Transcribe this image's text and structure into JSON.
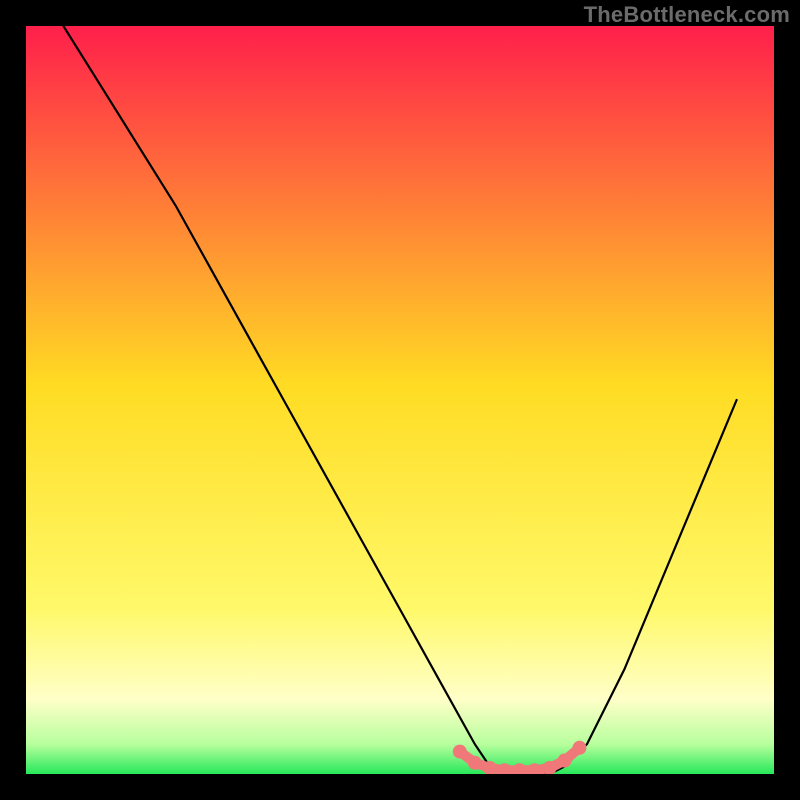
{
  "watermark": "TheBottleneck.com",
  "colors": {
    "bg": "#000000",
    "top": "#ff1f4b",
    "mid": "#ffdc23",
    "pale": "#ffffb0",
    "green": "#27e85a",
    "curve": "#000000",
    "marker": "#f07878"
  },
  "chart_data": {
    "type": "line",
    "title": "",
    "xlabel": "",
    "ylabel": "",
    "xlim": [
      0,
      100
    ],
    "ylim": [
      0,
      100
    ],
    "grid": false,
    "legend": false,
    "series": [
      {
        "name": "bottleneck-curve",
        "x": [
          5,
          10,
          15,
          20,
          25,
          30,
          35,
          40,
          45,
          50,
          55,
          60,
          62,
          65,
          68,
          70,
          72,
          75,
          80,
          85,
          90,
          95
        ],
        "values": [
          100,
          92,
          84,
          76,
          67,
          58,
          49,
          40,
          31,
          22,
          13,
          4,
          1,
          0,
          0,
          0,
          1,
          4,
          14,
          26,
          38,
          50
        ]
      }
    ],
    "markers": {
      "name": "highlighted-range",
      "style": "pink-dots",
      "x": [
        58,
        60,
        62,
        64,
        66,
        68,
        70,
        72,
        74
      ],
      "values": [
        3,
        1.5,
        0.8,
        0.5,
        0.5,
        0.5,
        0.8,
        1.8,
        3.5
      ]
    }
  }
}
